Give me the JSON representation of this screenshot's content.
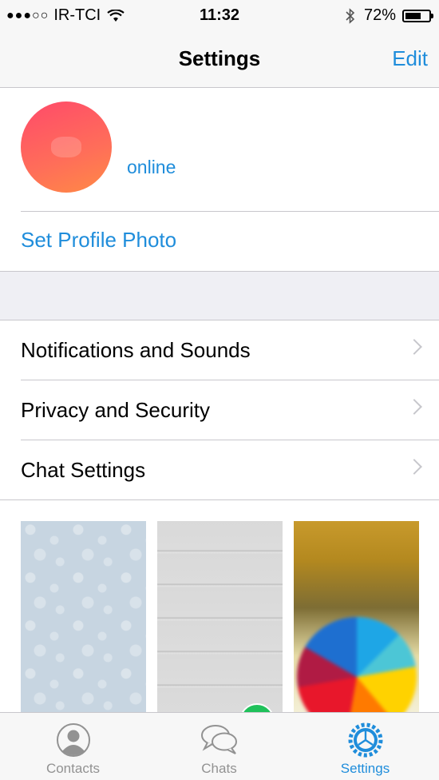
{
  "statusbar": {
    "carrier": "IR-TCI",
    "time": "11:32",
    "battery": "72%",
    "battery_level": 0.72
  },
  "navbar": {
    "title": "Settings",
    "edit_label": "Edit"
  },
  "profile": {
    "status": "online",
    "set_photo_label": "Set Profile Photo"
  },
  "menu": {
    "items": [
      {
        "label": "Notifications and Sounds"
      },
      {
        "label": "Privacy and Security"
      },
      {
        "label": "Chat Settings"
      }
    ]
  },
  "tabbar": {
    "tabs": [
      {
        "label": "Contacts",
        "icon": "person-icon",
        "active": false
      },
      {
        "label": "Chats",
        "icon": "chat-bubbles-icon",
        "active": false
      },
      {
        "label": "Settings",
        "icon": "gear-icon",
        "active": true
      }
    ]
  },
  "colors": {
    "accent": "#1f8ddb",
    "selected_check": "#1fc15a"
  }
}
